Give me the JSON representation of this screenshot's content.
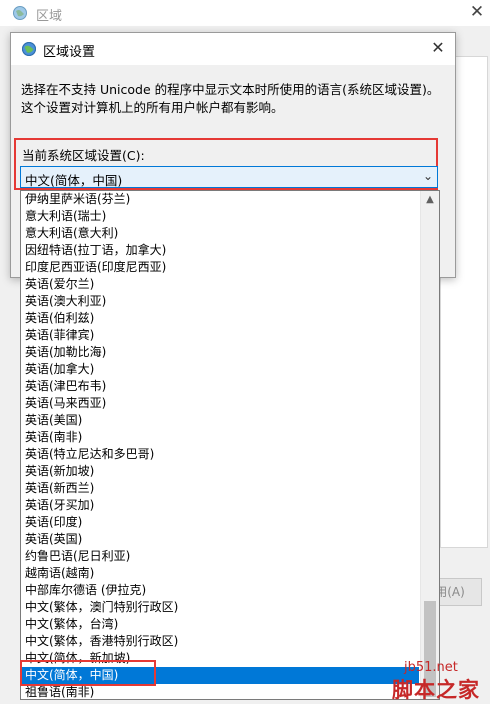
{
  "background_window": {
    "title": "区域",
    "button_label": "用(A)"
  },
  "dialog": {
    "title": "区域设置",
    "close_glyph": "✕",
    "description": "选择在不支持 Unicode 的程序中显示文本时所使用的语言(系统区域设置)。这个设置对计算机上的所有用户帐户都有影响。",
    "combo_label": "当前系统区域设置(C):",
    "combo_value": "中文(简体，中国)",
    "combo_arrow": "⌄"
  },
  "dropdown": {
    "items": [
      "伊纳里萨米语(芬兰)",
      "意大利语(瑞士)",
      "意大利语(意大利)",
      "因纽特语(拉丁语，加拿大)",
      "印度尼西亚语(印度尼西亚)",
      "英语(爱尔兰)",
      "英语(澳大利亚)",
      "英语(伯利兹)",
      "英语(菲律宾)",
      "英语(加勒比海)",
      "英语(加拿大)",
      "英语(津巴布韦)",
      "英语(马来西亚)",
      "英语(美国)",
      "英语(南非)",
      "英语(特立尼达和多巴哥)",
      "英语(新加坡)",
      "英语(新西兰)",
      "英语(牙买加)",
      "英语(印度)",
      "英语(英国)",
      "约鲁巴语(尼日利亚)",
      "越南语(越南)",
      "中部库尔德语 (伊拉克)",
      "中文(繁体，澳门特别行政区)",
      "中文(繁体，台湾)",
      "中文(繁体，香港特别行政区)",
      "中文(简体，新加坡)",
      "中文(简体，中国)",
      "祖鲁语(南非)"
    ],
    "selected_index": 28,
    "scroll_up_glyph": "▲"
  },
  "watermark": {
    "url": "jb51.net",
    "name": "脚本之家"
  }
}
